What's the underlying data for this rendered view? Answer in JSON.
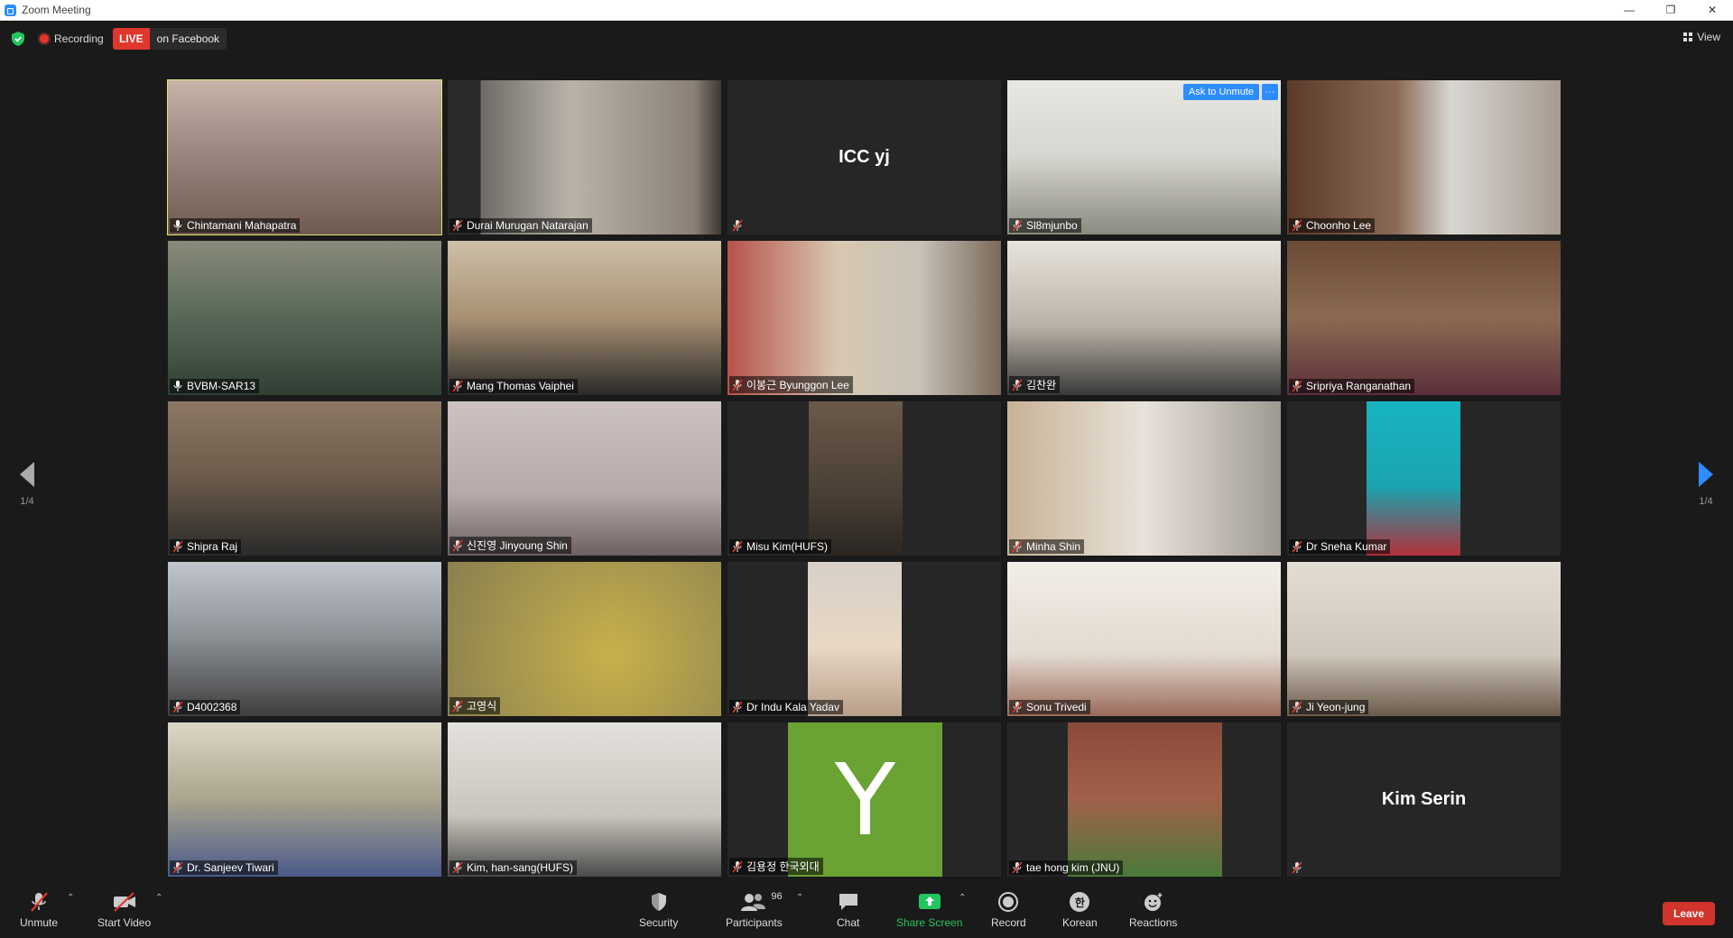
{
  "window": {
    "title": "Zoom Meeting"
  },
  "topbar": {
    "recording_label": "Recording",
    "live_badge": "LIVE",
    "live_destination": "on Facebook",
    "view_label": "View"
  },
  "pagination": {
    "left_page": "1/4",
    "right_page": "1/4"
  },
  "participants": [
    {
      "name": "Chintamani Mahapatra",
      "muted": false,
      "active": true
    },
    {
      "name": "Durai Murugan Natarajan",
      "muted": true
    },
    {
      "name": "",
      "display_name": "ICC yj",
      "muted": true,
      "video_off": true
    },
    {
      "name": "Sl8mjunbo",
      "muted": true,
      "overlay": {
        "ask_unmute": "Ask to Unmute",
        "more": "···"
      }
    },
    {
      "name": "Choonho Lee",
      "muted": true
    },
    {
      "name": "BVBM-SAR13",
      "muted": false
    },
    {
      "name": "Mang Thomas Vaiphei",
      "muted": true
    },
    {
      "name": "이봉근 Byunggon Lee",
      "muted": true
    },
    {
      "name": "김찬완",
      "muted": true
    },
    {
      "name": "Sripriya Ranganathan",
      "muted": true
    },
    {
      "name": "Shipra Raj",
      "muted": true
    },
    {
      "name": "신진영 Jinyoung Shin",
      "muted": true
    },
    {
      "name": "Misu Kim(HUFS)",
      "muted": true
    },
    {
      "name": "Minha Shin",
      "muted": true
    },
    {
      "name": "Dr Sneha Kumar",
      "muted": true
    },
    {
      "name": "D4002368",
      "muted": true
    },
    {
      "name": "고영식",
      "muted": true
    },
    {
      "name": "Dr Indu Kala Yadav",
      "muted": true
    },
    {
      "name": "Sonu Trivedi",
      "muted": true
    },
    {
      "name": "Ji Yeon-jung",
      "muted": true
    },
    {
      "name": "Dr. Sanjeev Tiwari",
      "muted": true
    },
    {
      "name": "Kim, han-sang(HUFS)",
      "muted": true
    },
    {
      "name": "김용정 한국외대",
      "muted": true,
      "avatar_letter": "Y"
    },
    {
      "name": "tae hong kim (JNU)",
      "muted": true
    },
    {
      "name": "",
      "display_name": "Kim Serin",
      "muted": true,
      "video_off": true
    }
  ],
  "toolbar": {
    "unmute": "Unmute",
    "start_video": "Start Video",
    "security": "Security",
    "participants": "Participants",
    "participants_count": "96",
    "chat": "Chat",
    "share_screen": "Share Screen",
    "record": "Record",
    "korean": "Korean",
    "korean_glyph": "한",
    "reactions": "Reactions",
    "leave": "Leave"
  },
  "colors": {
    "accent": "#2d8cff",
    "live": "#e0362c",
    "active_speaker": "#d8e86b",
    "share_green": "#22c55e",
    "avatar_green": "#6aa233"
  }
}
